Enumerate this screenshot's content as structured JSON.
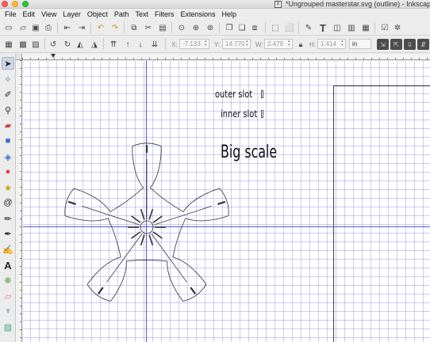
{
  "window": {
    "title": "*Ungrouped masterstar.svg (outline) - Inkscape",
    "doc_icon": "X"
  },
  "menu": [
    "File",
    "Edit",
    "View",
    "Layer",
    "Object",
    "Path",
    "Text",
    "Filters",
    "Extensions",
    "Help"
  ],
  "commands_bar": {
    "icons": [
      "new-document-icon",
      "open-icon",
      "save-icon",
      "print-icon",
      "import-icon",
      "export-icon",
      "undo-icon",
      "redo-icon",
      "copy-icon",
      "cut-icon",
      "paste-icon",
      "zoom-selection-icon",
      "zoom-drawing-icon",
      "zoom-page-icon",
      "duplicate-icon",
      "clone-icon",
      "unlink-clone-icon",
      "group-icon",
      "ungroup-icon",
      "fill-stroke-icon",
      "text-font-icon",
      "layers-icon",
      "xml-editor-icon",
      "align-icon",
      "preferences-icon",
      "snap-icon"
    ]
  },
  "tool_controls": {
    "x_label": "X:",
    "x_value": "-7.133",
    "y_label": "Y:",
    "y_value": "14.770",
    "w_label": "W:",
    "w_value": "2.479",
    "h_label": "H:",
    "h_value": "1.414",
    "unit": "in",
    "lock_icon": "lock-icon"
  },
  "tools": [
    "selector-tool",
    "node-tool",
    "tweak-tool",
    "zoom-tool",
    "measure-tool",
    "rectangle-tool",
    "3d-box-tool",
    "ellipse-tool",
    "star-tool",
    "spiral-tool",
    "pencil-tool",
    "pen-tool",
    "calligraphy-tool",
    "text-tool",
    "spray-tool",
    "eraser-tool",
    "paint-bucket-tool",
    "gradient-tool"
  ],
  "canvas": {
    "labels": {
      "outer_slot": "outer slot",
      "inner_slot": "inner slot",
      "big_scale": "Big scale"
    },
    "view_mode": "outline",
    "guide_color": "#5a5ad6",
    "grid_color": "#7878f0"
  }
}
